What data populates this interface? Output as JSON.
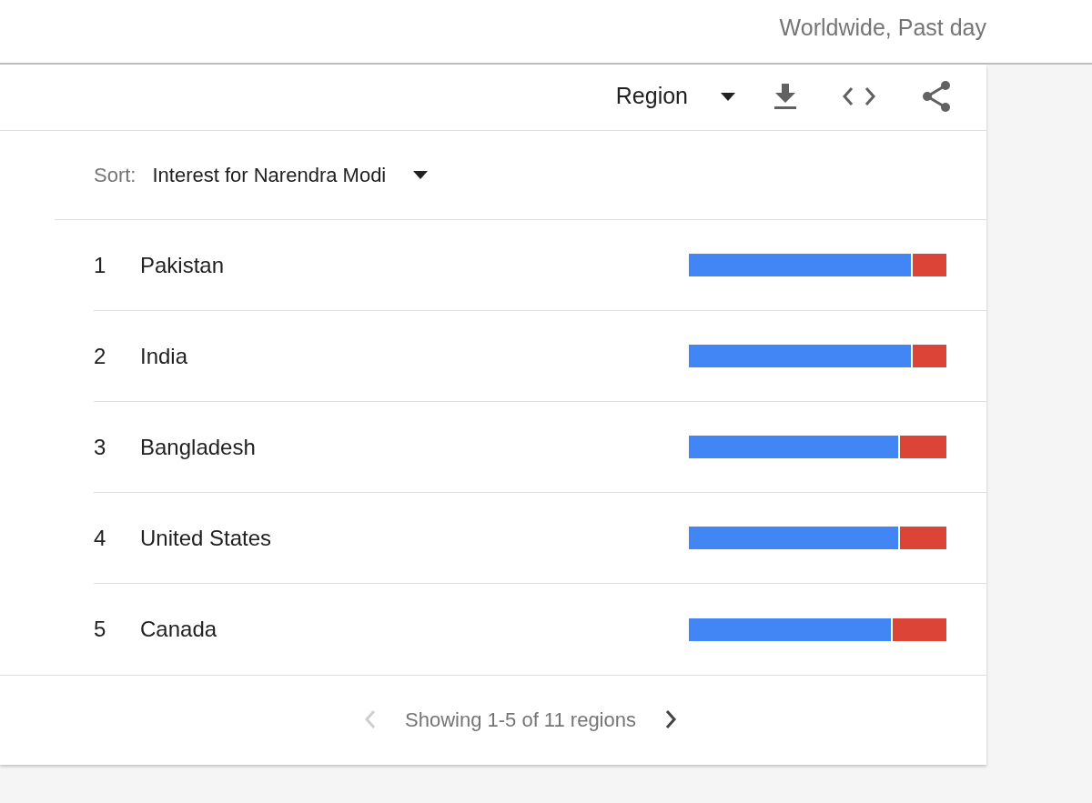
{
  "header": {
    "scope": "Worldwide, Past day"
  },
  "toolbar": {
    "view_select": "Region"
  },
  "sort": {
    "label": "Sort:",
    "value": "Interest for Narendra Modi"
  },
  "rows": [
    {
      "rank": "1",
      "name": "Pakistan",
      "level": 0.87
    },
    {
      "rank": "2",
      "name": "India",
      "level": 0.87
    },
    {
      "rank": "3",
      "name": "Bangladesh",
      "level": 0.82
    },
    {
      "rank": "4",
      "name": "United States",
      "level": 0.82
    },
    {
      "rank": "5",
      "name": "Canada",
      "level": 0.79
    }
  ],
  "pager": {
    "text": "Showing 1-5 of 11 regions",
    "prev_disabled": true,
    "next_disabled": false
  }
}
